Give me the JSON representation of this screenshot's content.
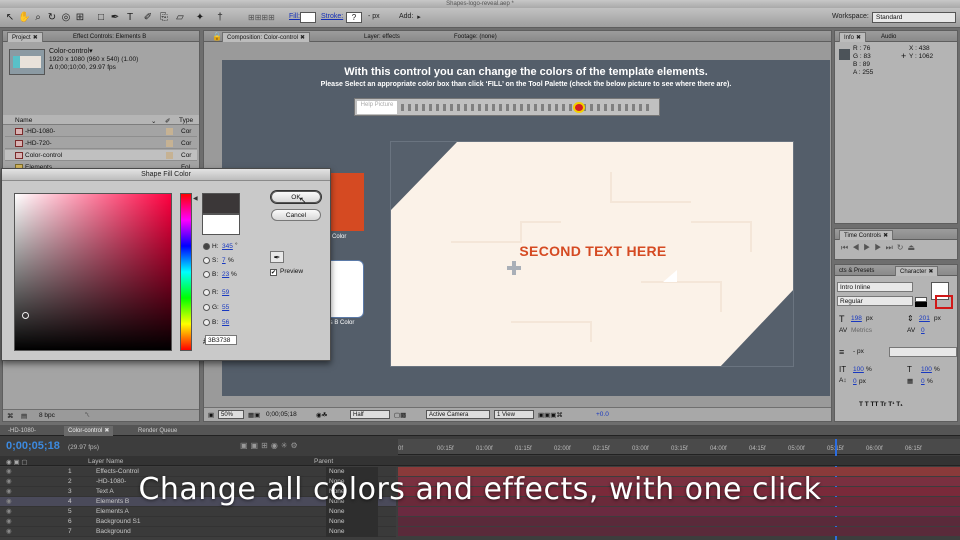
{
  "window_title": "Shapes-logo-reveal.aep *",
  "toolbar": {
    "fill_label": "Fill:",
    "stroke_label": "Stroke:",
    "stroke_value": "?",
    "stroke_px": "- px",
    "add_label": "Add:",
    "workspace_label": "Workspace:",
    "workspace_value": "Standard"
  },
  "project_panel": {
    "tabs": [
      "Project",
      "Effect Controls: Elements B"
    ],
    "item_name": "Color-control▾",
    "item_dims": "1920 x 1080  (960 x 540) (1.00)",
    "item_duration": "Δ 0;00;10;00, 29.97 fps",
    "col_name": "Name",
    "col_type": "Type",
    "rows": [
      {
        "name": "-HD-1080-",
        "type": "Cor"
      },
      {
        "name": "-HD-720-",
        "type": "Cor"
      },
      {
        "name": "Color-control",
        "type": "Cor"
      },
      {
        "name": "Elements",
        "type": "Fol"
      }
    ],
    "bpc": "8 bpc"
  },
  "comp_panel": {
    "tabs": [
      "Composition: Color-control",
      "Layer: effects",
      "Footage: (none)"
    ],
    "heading": "With this control you can change the colors of the template elements.",
    "subheading": "Please Select an appropriate color box than click ‘FILL’ on the Tool Palette (check the below picture to see where there are).",
    "help_label": "Help\nPicture",
    "card_text": "SECOND TEXT HERE",
    "color_label_a": "Color",
    "color_label_b": "ts B Color",
    "footer": {
      "zoom": "50%",
      "timecode": "0;00;05;18",
      "resolution": "Half",
      "camera": "Active Camera",
      "views": "1 View",
      "exposure": "+0.0"
    }
  },
  "fill_dialog": {
    "title": "Shape Fill Color",
    "ok_label": "OK",
    "cancel_label": "Cancel",
    "h_label": "H:",
    "h_value": "345",
    "s_label": "S:",
    "s_value": "7",
    "b_label": "B:",
    "b_value": "23",
    "r_label": "R:",
    "r_value": "59",
    "g_label": "G:",
    "g_value": "55",
    "bb_label": "B:",
    "bb_value": "56",
    "hex_value": "3B3738",
    "preview_label": "Preview",
    "new_color": "#3b3738",
    "old_color": "#ffffff"
  },
  "info_panel": {
    "tabs": [
      "Info",
      "Audio"
    ],
    "r": "R : 76",
    "g": "G : 83",
    "b": "B : 89",
    "a": "A : 255",
    "x": "X : 438",
    "y": "Y : 1062"
  },
  "time_controls": {
    "tab": "Time Controls"
  },
  "character_panel": {
    "tabs": [
      "cts & Presets",
      "Character"
    ],
    "font": "Intro Inline",
    "style": "Regular",
    "size": "198",
    "leading": "201",
    "kerning": "Metrics",
    "tracking": "0",
    "stroke_px": "- px",
    "vscale": "100",
    "hscale": "100",
    "baseline": "0",
    "tsume": "0",
    "unit_px": "px",
    "unit_pct": "%",
    "style_buttons": "T  T  TT  Tr  T¹  T₁"
  },
  "timeline": {
    "tabs": [
      "-HD-1080-",
      "Color-control",
      "Render Queue"
    ],
    "timecode": "0;00;05;18",
    "fps": "(29.97 fps)",
    "col_layer": "Layer Name",
    "col_parent": "Parent",
    "ticks": [
      "0f",
      "00:15f",
      "01:00f",
      "01:15f",
      "02:00f",
      "02:15f",
      "03:00f",
      "03:15f",
      "04:00f",
      "04:15f",
      "05:00f",
      "05:15f",
      "06:00f",
      "06:15f"
    ],
    "layers": [
      {
        "num": "1",
        "name": "Effects-Control",
        "parent": "None"
      },
      {
        "num": "2",
        "name": "-HD-1080-",
        "parent": "None"
      },
      {
        "num": "3",
        "name": "Text A",
        "parent": "None"
      },
      {
        "num": "4",
        "name": "Elements B",
        "parent": "None"
      },
      {
        "num": "5",
        "name": "Elements A",
        "parent": "None"
      },
      {
        "num": "6",
        "name": "Background S1",
        "parent": "None"
      },
      {
        "num": "7",
        "name": "Background",
        "parent": "None"
      }
    ]
  },
  "overlay_caption": "Change all colors and effects, with one click",
  "colors": {
    "accent_orange": "#d54a22",
    "card_bg": "#fbf2e8",
    "slate": "#56606c"
  }
}
